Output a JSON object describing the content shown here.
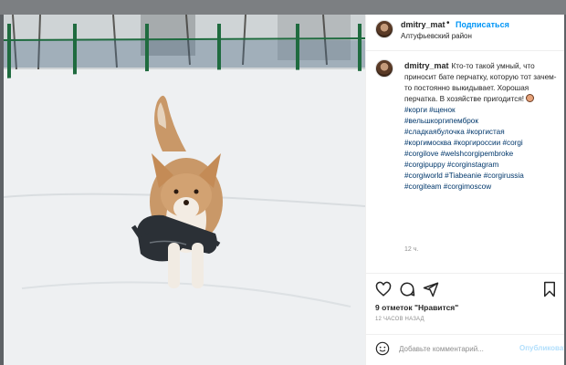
{
  "post": {
    "username": "dmitry_mat",
    "follow_label": "Подписаться",
    "dot": "•",
    "location": "Алтуфьевский район",
    "caption_text": "Кто-то такой умный, что приносит бате перчатку, которую тот зачем-то постоянно выкидывает. Хорошая перчатка. В хозяйстве пригодится!",
    "hashtags": [
      "#корги #щенок",
      "#вельшкоргипемброк",
      "#сладкаябулочка #коргистая",
      "#коргимосква #коргироссии #corgi",
      "#corgilove #welshcorgipembroke",
      "#corgipuppy #corginstagram",
      "#corgiworld #Tiabeanie #corgirussia",
      "#corgiteam #corgimoscow"
    ],
    "comment_time": "12 ч.",
    "likes": "9 отметок \"Нравится\"",
    "posted_ago": "12 ЧАСОВ НАЗАД",
    "comment_placeholder": "Добавьте комментарий...",
    "publish_label": "Опубликовать"
  },
  "icons": {
    "like": "heart-icon",
    "comment": "comment-icon",
    "share": "share-icon",
    "save": "bookmark-icon",
    "emoji": "smiley-icon"
  },
  "colors": {
    "link_blue": "#0095f6",
    "hashtag": "#00376b",
    "muted": "#8e8e8e",
    "publish_disabled": "#b2dffc"
  }
}
